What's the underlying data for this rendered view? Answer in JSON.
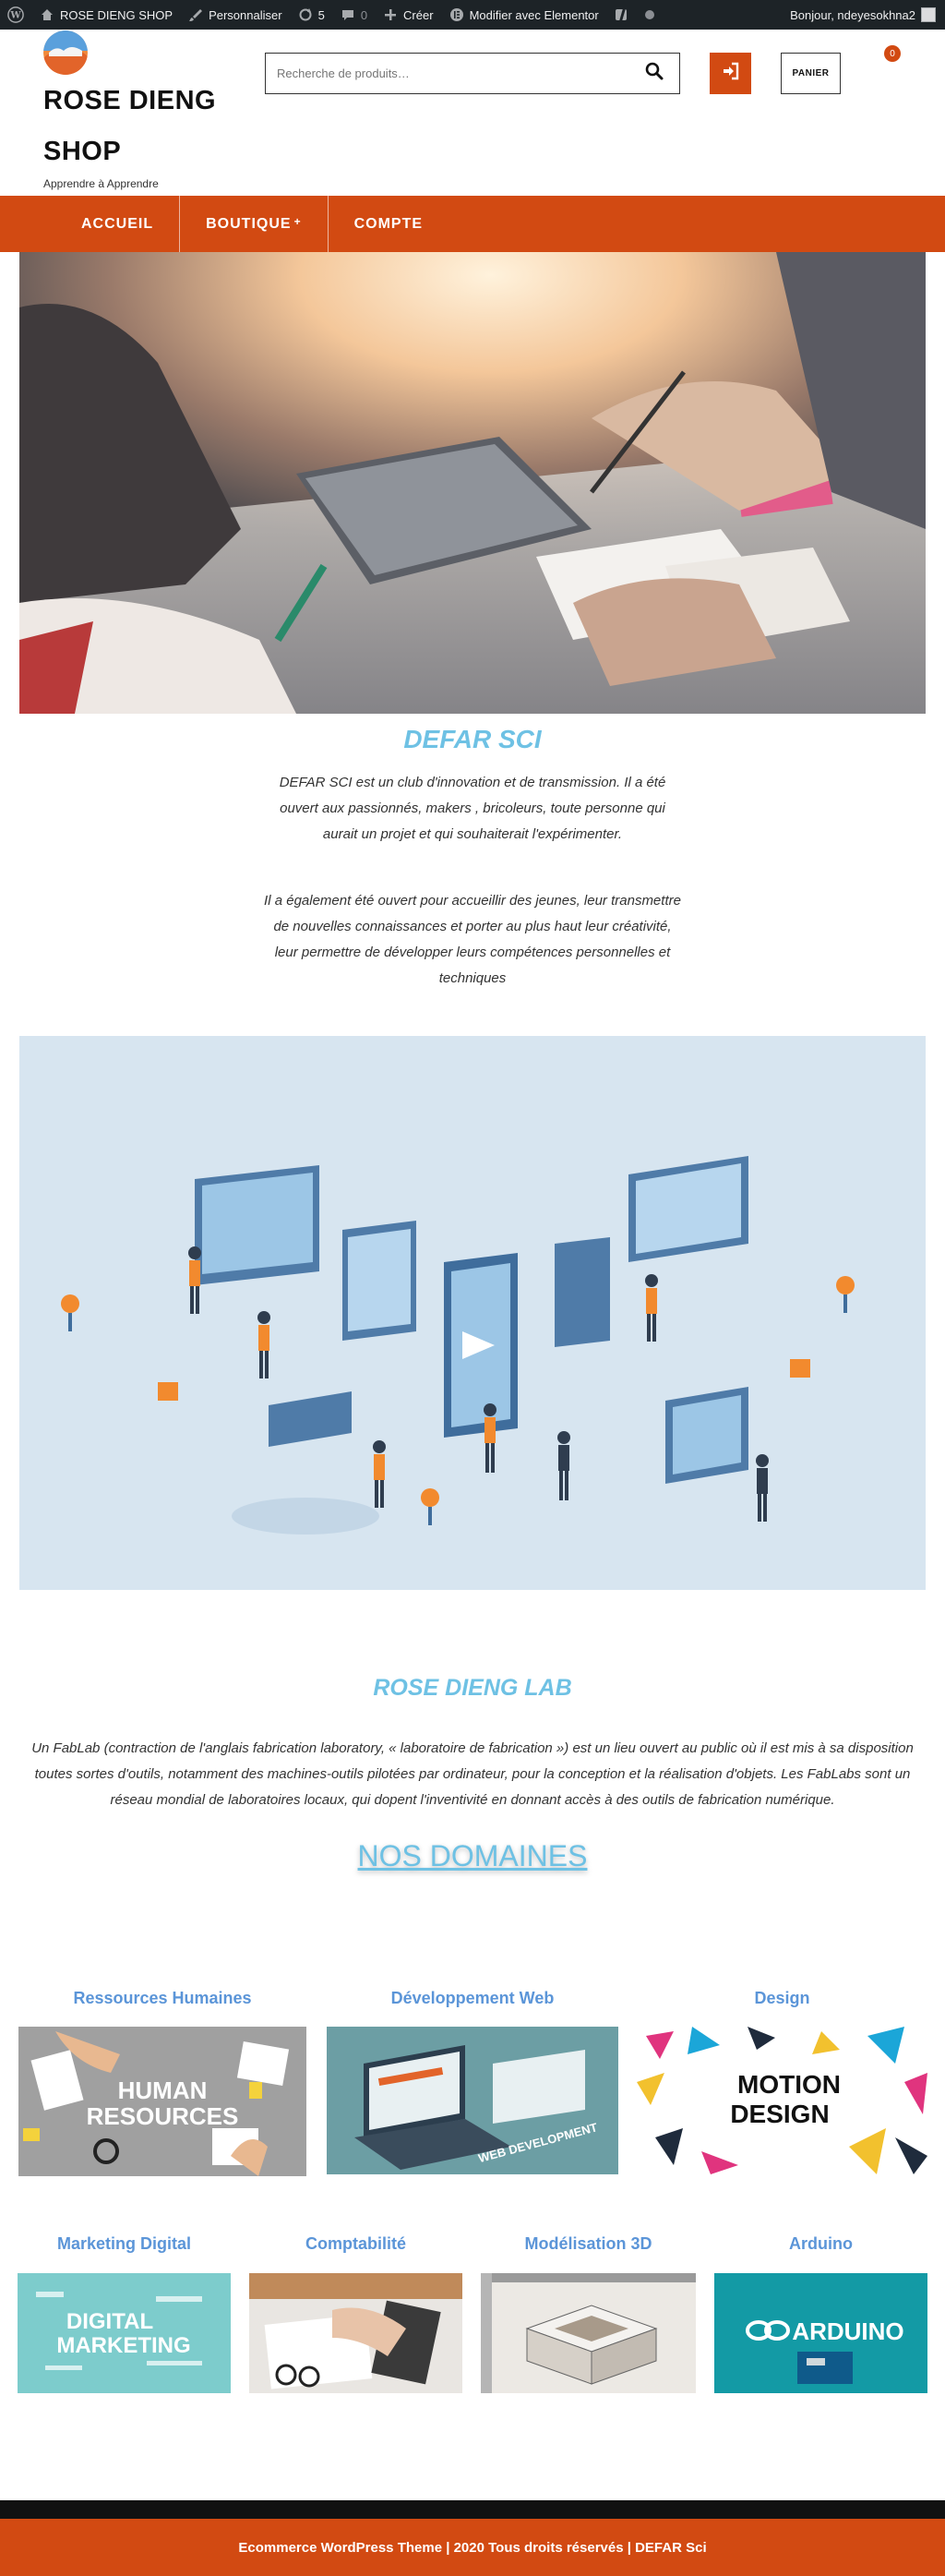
{
  "adminbar": {
    "site_name": "ROSE DIENG SHOP",
    "customize": "Personnaliser",
    "updates_count": "5",
    "comments_count": "0",
    "create": "Créer",
    "elementor": "Modifier avec Elementor",
    "greeting": "Bonjour, ndeyesokhna2"
  },
  "header": {
    "site_title": "ROSE DIENG SHOP",
    "tagline": "Apprendre à Apprendre",
    "search_placeholder": "Recherche de produits…",
    "cart_label": "PANIER",
    "cart_count": "0"
  },
  "nav": {
    "items": [
      {
        "label": "ACCUEIL"
      },
      {
        "label": "BOUTIQUE"
      },
      {
        "label": "COMPTE"
      }
    ],
    "boutique_marker": "+"
  },
  "intro": {
    "title": "DEFAR SCI",
    "paragraph1": "DEFAR SCI est un club d'innovation et de transmission. Il a été ouvert aux passionnés, makers , bricoleurs, toute personne qui aurait un projet et qui souhaiterait l'expérimenter.",
    "paragraph2": "Il a également été ouvert pour accueillir des jeunes, leur transmettre de nouvelles connaissances et porter au plus haut leur créativité, leur permettre de développer leurs compétences personnelles et techniques"
  },
  "lab": {
    "title": "ROSE DIENG LAB",
    "text": "Un FabLab (contraction de l'anglais fabrication laboratory, « laboratoire de fabrication ») est un lieu ouvert au public où il est mis à sa disposition toutes sortes d'outils, notamment des machines-outils pilotées par ordinateur, pour la conception et la réalisation d'objets. Les FabLabs sont un réseau mondial de laboratoires locaux, qui dopent l'inventivité en donnant accès à des outils de fabrication numérique."
  },
  "domaines": {
    "title": "NOS DOMAINES",
    "row1": [
      {
        "label": "Ressources Humaines",
        "img_text1": "HUMAN",
        "img_text2": "RESOURCES"
      },
      {
        "label": "Développement Web",
        "img_text1": "WEB DEVELOPMENT"
      },
      {
        "label": "Design",
        "img_text1": "MOTION",
        "img_text2": "DESIGN"
      }
    ],
    "row2": [
      {
        "label": "Marketing Digital",
        "img_text1": "DIGITAL",
        "img_text2": "MARKETING"
      },
      {
        "label": "Comptabilité"
      },
      {
        "label": "Modélisation 3D"
      },
      {
        "label": "Arduino",
        "img_text1": "ARDUINO"
      }
    ]
  },
  "footer": {
    "text": "Ecommerce WordPress Theme | 2020 Tous droits réservés | DEFAR Sci"
  },
  "colors": {
    "accent": "#d24a12",
    "title_blue": "#6ec1e4",
    "domain_blue": "#5b95d8",
    "adminbar": "#1d2327"
  }
}
